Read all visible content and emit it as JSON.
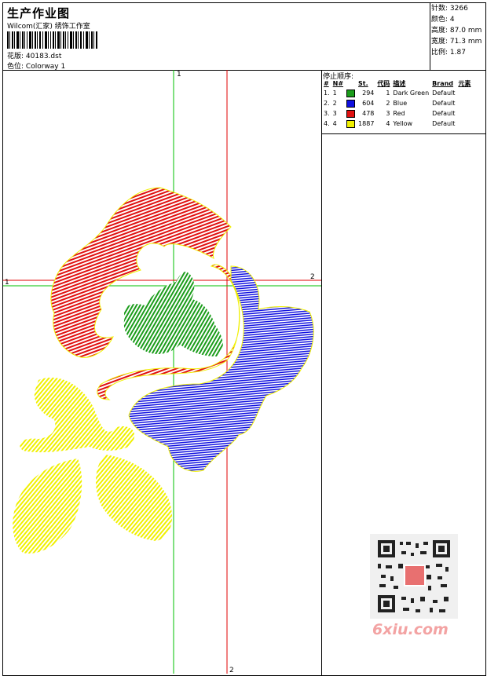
{
  "header": {
    "title": "生产作业图",
    "company": "Wilcom(汇家) 绣饰工作室",
    "design_label": "花版:",
    "design_value": "40183.dst",
    "colorway_label": "色位:",
    "colorway_value": "Colorway 1"
  },
  "stats": [
    {
      "label": "针数",
      "value": "3266"
    },
    {
      "label": "颜色",
      "value": "4"
    },
    {
      "label": "高度",
      "value": "87.0 mm"
    },
    {
      "label": "宽度",
      "value": "71.3 mm"
    },
    {
      "label": "比例",
      "value": "1.87"
    }
  ],
  "stop_sequence": {
    "title": "停止顺序:",
    "headers": [
      "#",
      "N#",
      "St.",
      "代码",
      "描述",
      "Brand",
      "元素"
    ],
    "rows": [
      {
        "num": "1.",
        "n": "1",
        "color": "#1a9c1a",
        "st": "294",
        "code": "1",
        "desc": "Dark Green",
        "brand": "Default"
      },
      {
        "num": "2.",
        "n": "2",
        "color": "#1010e0",
        "st": "604",
        "code": "2",
        "desc": "Blue",
        "brand": "Default"
      },
      {
        "num": "3.",
        "n": "3",
        "color": "#e01010",
        "st": "478",
        "code": "3",
        "desc": "Red",
        "brand": "Default"
      },
      {
        "num": "4.",
        "n": "4",
        "color": "#f0f000",
        "st": "1887",
        "code": "4",
        "desc": "Yellow",
        "brand": "Default"
      }
    ]
  },
  "guides": {
    "green_v": "1",
    "red_h": "2",
    "green_h": "1",
    "red_v": "2"
  },
  "watermark": "6xiu.com"
}
